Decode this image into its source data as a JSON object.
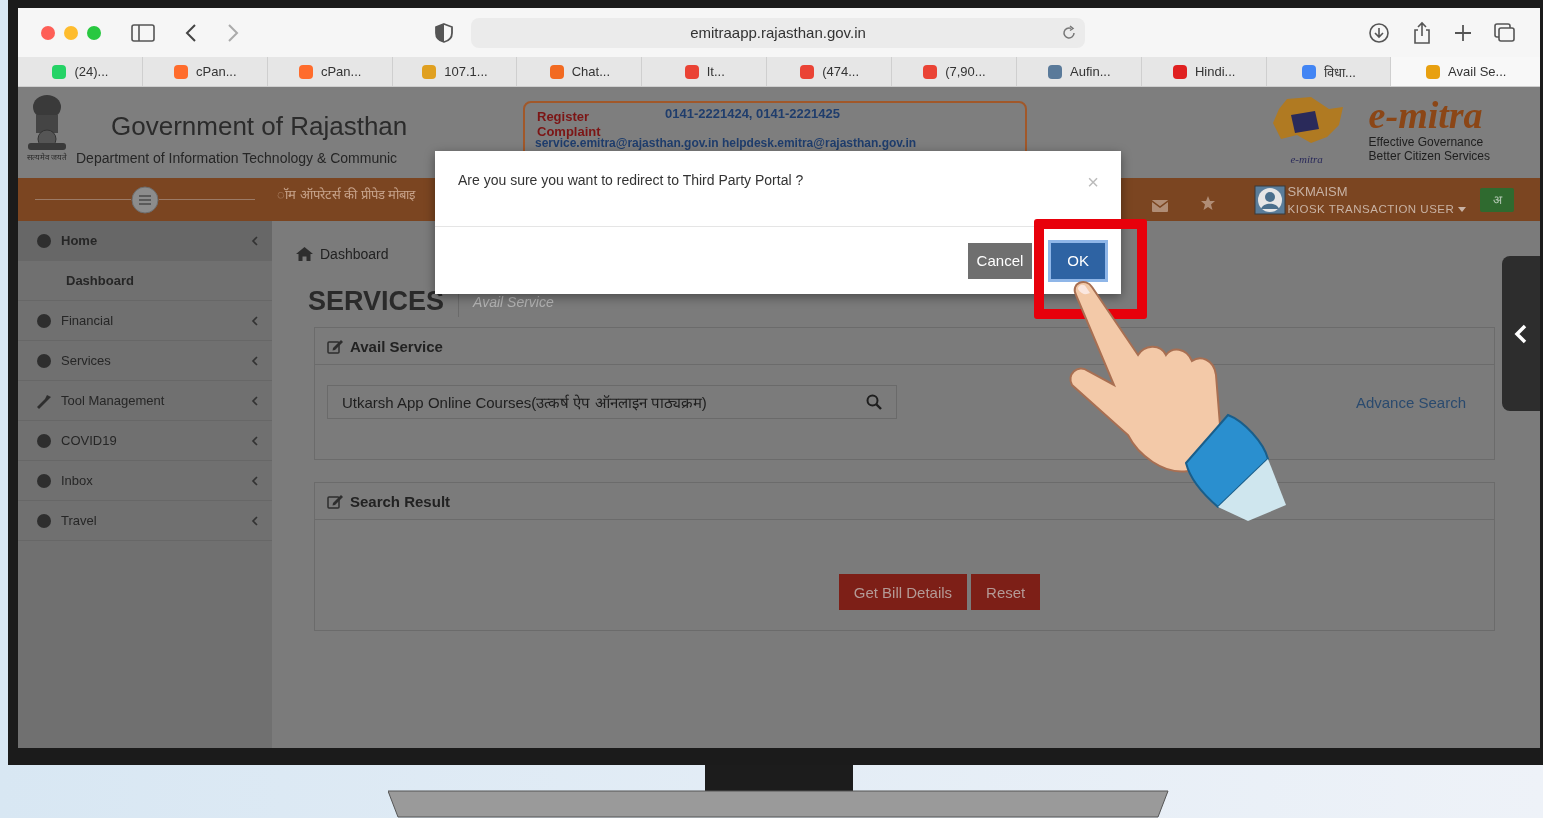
{
  "browser": {
    "address": "emitraapp.rajasthan.gov.in",
    "bookmarks": [
      {
        "label": "(24)...",
        "selected": false
      },
      {
        "label": "cPan...",
        "selected": false
      },
      {
        "label": "cPan...",
        "selected": false
      },
      {
        "label": "107.1...",
        "selected": false
      },
      {
        "label": "Chat...",
        "selected": false
      },
      {
        "label": "It...",
        "selected": false
      },
      {
        "label": "(474...",
        "selected": false
      },
      {
        "label": "(7,90...",
        "selected": false
      },
      {
        "label": "Aufin...",
        "selected": false
      },
      {
        "label": "Hindi...",
        "selected": false
      },
      {
        "label": "विधा...",
        "selected": false
      },
      {
        "label": "Avail Se...",
        "selected": true
      }
    ]
  },
  "header": {
    "title": "Government of Rajasthan",
    "subtitle": "Department of Information Technology & Communic",
    "motto": "सत्यमेव जयते",
    "register": "Register Complaint",
    "phones": "0141-2221424, 0141-2221425",
    "emails": "service.emitra@rajasthan.gov.in helpdesk.emitra@rajasthan.gov.in",
    "logo": "e-mitra",
    "logo_small": "e-mitra",
    "tagline": [
      "Effective Governance",
      "Better Citizen Services"
    ]
  },
  "navbar": {
    "ticker": "ॉम ऑपरेटर्स की प्रीपेड मोबाइ",
    "user": "SKMAISM",
    "role": "KIOSK TRANSACTION USER",
    "language": "अ"
  },
  "sidebar": {
    "items": [
      {
        "label": "Home",
        "expanded": true,
        "children": [
          {
            "label": "Dashboard"
          }
        ]
      },
      {
        "label": "Financial",
        "expanded": false
      },
      {
        "label": "Services",
        "expanded": false
      },
      {
        "label": "Tool Management",
        "expanded": false
      },
      {
        "label": "COVID19",
        "expanded": false
      },
      {
        "label": "Inbox",
        "expanded": false
      },
      {
        "label": "Travel",
        "expanded": false
      }
    ]
  },
  "breadcrumb": "Dashboard",
  "page_title": "SERVICES",
  "page_subtitle": "Avail Service",
  "avail_panel": {
    "title": "Avail Service",
    "search": {
      "value": "Utkarsh App Online Courses(उत्कर्ष ऐप ऑनलाइन पाठ्यक्रम)"
    },
    "advance_link": "Advance Search"
  },
  "result_panel": {
    "title": "Search Result",
    "buttons": [
      "Get Bill Details",
      "Reset"
    ]
  },
  "dialog": {
    "message": "Are you sure you want to redirect to Third Party Portal ?",
    "close": "×",
    "buttons": [
      {
        "label": "Cancel",
        "kind": "secondary"
      },
      {
        "label": "OK",
        "kind": "primary"
      }
    ]
  }
}
